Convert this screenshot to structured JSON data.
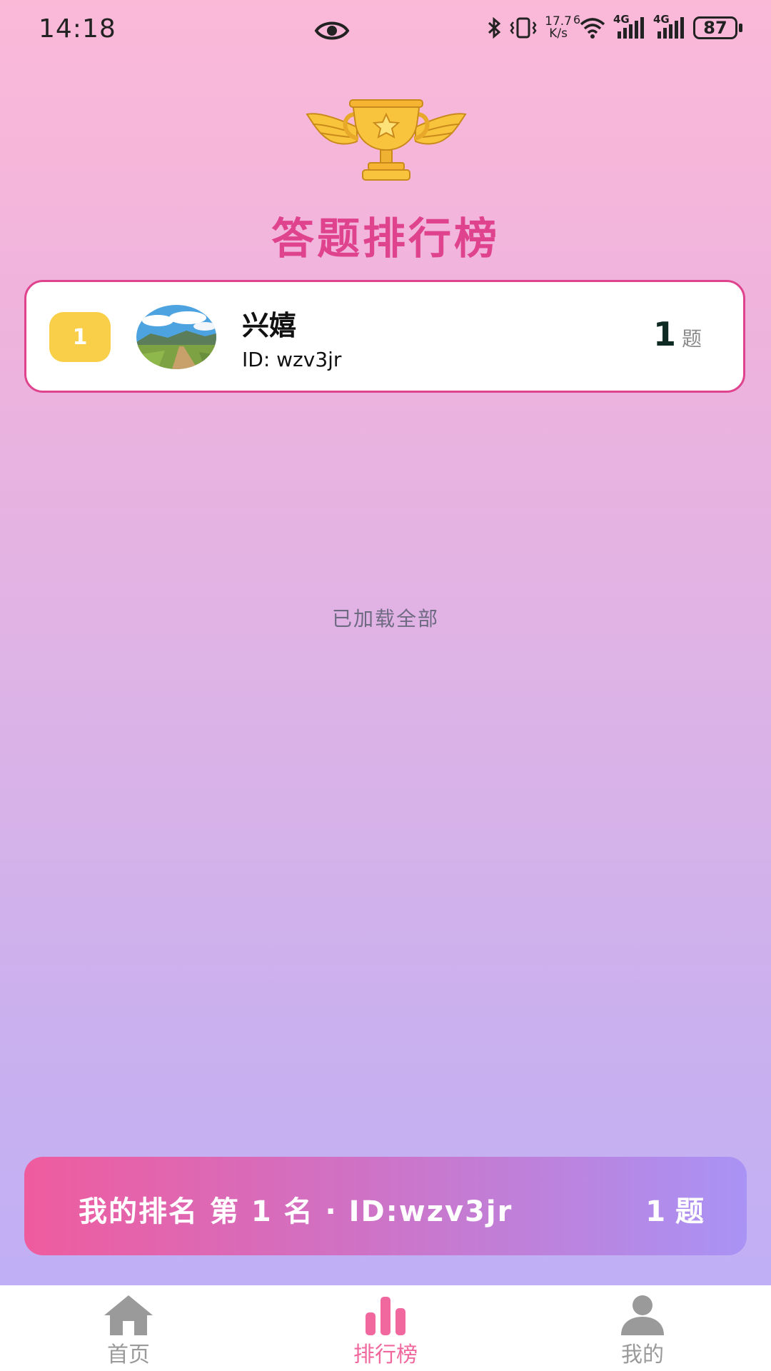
{
  "status_bar": {
    "time": "14:18",
    "net_speed_value": "17.7",
    "net_speed_unit": "K/s",
    "wifi_sup": "6",
    "signal1_label": "4G",
    "signal2_label": "4G",
    "battery": "87"
  },
  "header": {
    "trophy_icon": "winged-trophy-icon",
    "title": "答题排行榜"
  },
  "leaderboard": {
    "entries": [
      {
        "rank": "1",
        "name": "兴嬉",
        "id_text": "ID: wzv3jr",
        "score": "1",
        "score_unit": "题",
        "badge_color": "#f9cf49"
      }
    ],
    "footer_text": "已加载全部"
  },
  "my_rank": {
    "text": "我的排名 第 1 名 · ID:wzv3jr",
    "score": "1 题"
  },
  "tab_bar": {
    "active_color": "#f0689e",
    "inactive_color": "#9a9a9a",
    "tabs": [
      {
        "label": "首页",
        "icon": "home-icon"
      },
      {
        "label": "排行榜",
        "icon": "bar-chart-icon"
      },
      {
        "label": "我的",
        "icon": "person-icon"
      }
    ]
  }
}
